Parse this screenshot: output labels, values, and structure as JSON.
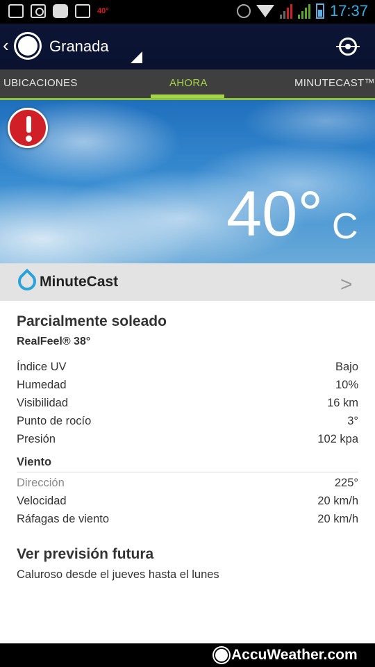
{
  "status_bar": {
    "time": "17:37",
    "temp_badge": "40°"
  },
  "header": {
    "location": "Granada"
  },
  "tabs": [
    {
      "label": "UBICACIONES"
    },
    {
      "label": "AHORA"
    },
    {
      "label": "MINUTECAST™"
    }
  ],
  "current": {
    "temperature": "40°",
    "unit": "C"
  },
  "minutecast": {
    "label": "MinuteCast"
  },
  "details": {
    "condition": "Parcialmente soleado",
    "realfeel": "RealFeel® 38°",
    "rows": [
      {
        "label": "Índice UV",
        "value": "Bajo"
      },
      {
        "label": "Humedad",
        "value": "10%"
      },
      {
        "label": "Visibilidad",
        "value": "16 km"
      },
      {
        "label": "Punto de rocío",
        "value": "3°"
      },
      {
        "label": "Presión",
        "value": "102 kpa"
      }
    ],
    "wind_title": "Viento",
    "wind_rows": [
      {
        "label": "Dirección",
        "value": "225°"
      },
      {
        "label": "Velocidad",
        "value": "20 km/h"
      },
      {
        "label": "Ráfagas de viento",
        "value": "20 km/h"
      }
    ]
  },
  "forecast": {
    "title": "Ver previsión futura",
    "subtitle": "Caluroso desde el jueves hasta el lunes"
  },
  "footer": {
    "brand": "AccuWeather.com"
  },
  "colors": {
    "accent_green": "#a5d447",
    "status_time": "#37b0e8",
    "alert_red": "#d01f26"
  }
}
